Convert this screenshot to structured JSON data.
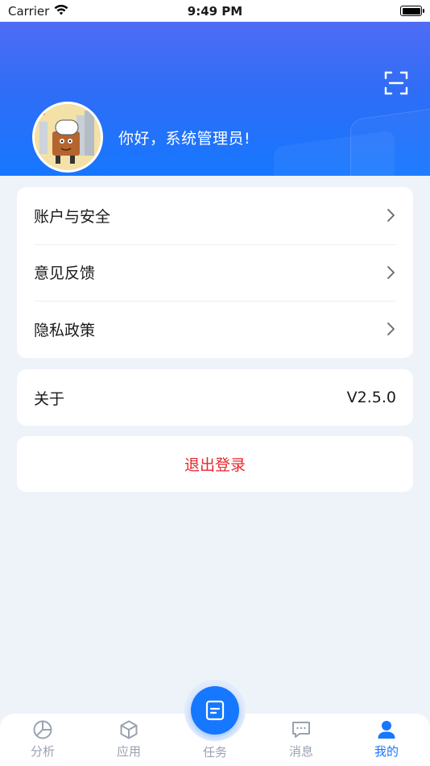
{
  "status_bar": {
    "carrier": "Carrier",
    "time": "9:49 PM"
  },
  "header": {
    "greeting": "你好，系统管理员!",
    "scan_icon": "scan-icon",
    "gradient_top": "#4f6cf5",
    "gradient_bottom": "#1677ff"
  },
  "menu": {
    "items": [
      {
        "label": "账户与安全"
      },
      {
        "label": "意见反馈"
      },
      {
        "label": "隐私政策"
      }
    ]
  },
  "about": {
    "label": "关于",
    "version": "V2.5.0"
  },
  "logout": {
    "label": "退出登录",
    "color": "#e8262e"
  },
  "tabbar": {
    "active_color": "#1677ff",
    "inactive_color": "#9aa2b1",
    "tabs": [
      {
        "label": "分析",
        "icon": "pie-chart-icon",
        "active": false
      },
      {
        "label": "应用",
        "icon": "cube-icon",
        "active": false
      },
      {
        "label": "任务",
        "icon": "task-doc-icon",
        "active": false
      },
      {
        "label": "消息",
        "icon": "message-icon",
        "active": false
      },
      {
        "label": "我的",
        "icon": "user-icon",
        "active": true
      }
    ]
  }
}
